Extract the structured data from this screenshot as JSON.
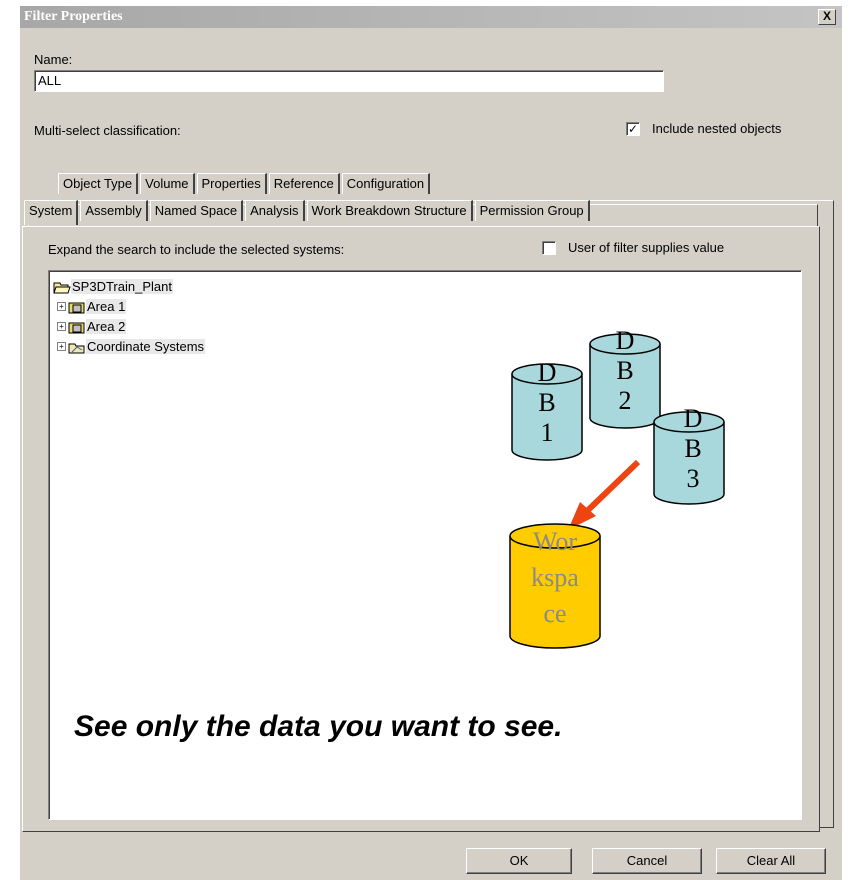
{
  "title": "Filter Properties",
  "close_label": "X",
  "name_label": "Name:",
  "name_value": "ALL",
  "classification_label": "Multi-select classification:",
  "include_nested": {
    "label": "Include nested objects",
    "checked": true
  },
  "tabs_back": [
    "Object Type",
    "Volume",
    "Properties",
    "Reference",
    "Configuration"
  ],
  "tabs_front": [
    "System",
    "Assembly",
    "Named Space",
    "Analysis",
    "Work Breakdown Structure",
    "Permission Group"
  ],
  "search_label": "Expand the search to include the selected systems:",
  "user_of_filter": {
    "label": "User of filter supplies value",
    "checked": false
  },
  "tree": {
    "root": "SP3DTrain_Plant",
    "items": [
      "Area 1",
      "Area 2",
      "Coordinate Systems"
    ]
  },
  "databases": [
    {
      "label": "DB1",
      "lines": [
        "D",
        "B",
        "1"
      ]
    },
    {
      "label": "DB2",
      "lines": [
        "D",
        "B",
        "2"
      ]
    },
    {
      "label": "DB3",
      "lines": [
        "D",
        "B",
        "3"
      ]
    }
  ],
  "workspace": {
    "lines": [
      "Wor",
      "kspa",
      "ce"
    ]
  },
  "slogan": "See only the data you want to see.",
  "buttons": {
    "ok": "OK",
    "cancel": "Cancel",
    "clear_all": "Clear All"
  },
  "colors": {
    "db_fill": "#a8d8dc",
    "workspace_fill": "#ffcc00",
    "arrow": "#ee4411"
  }
}
